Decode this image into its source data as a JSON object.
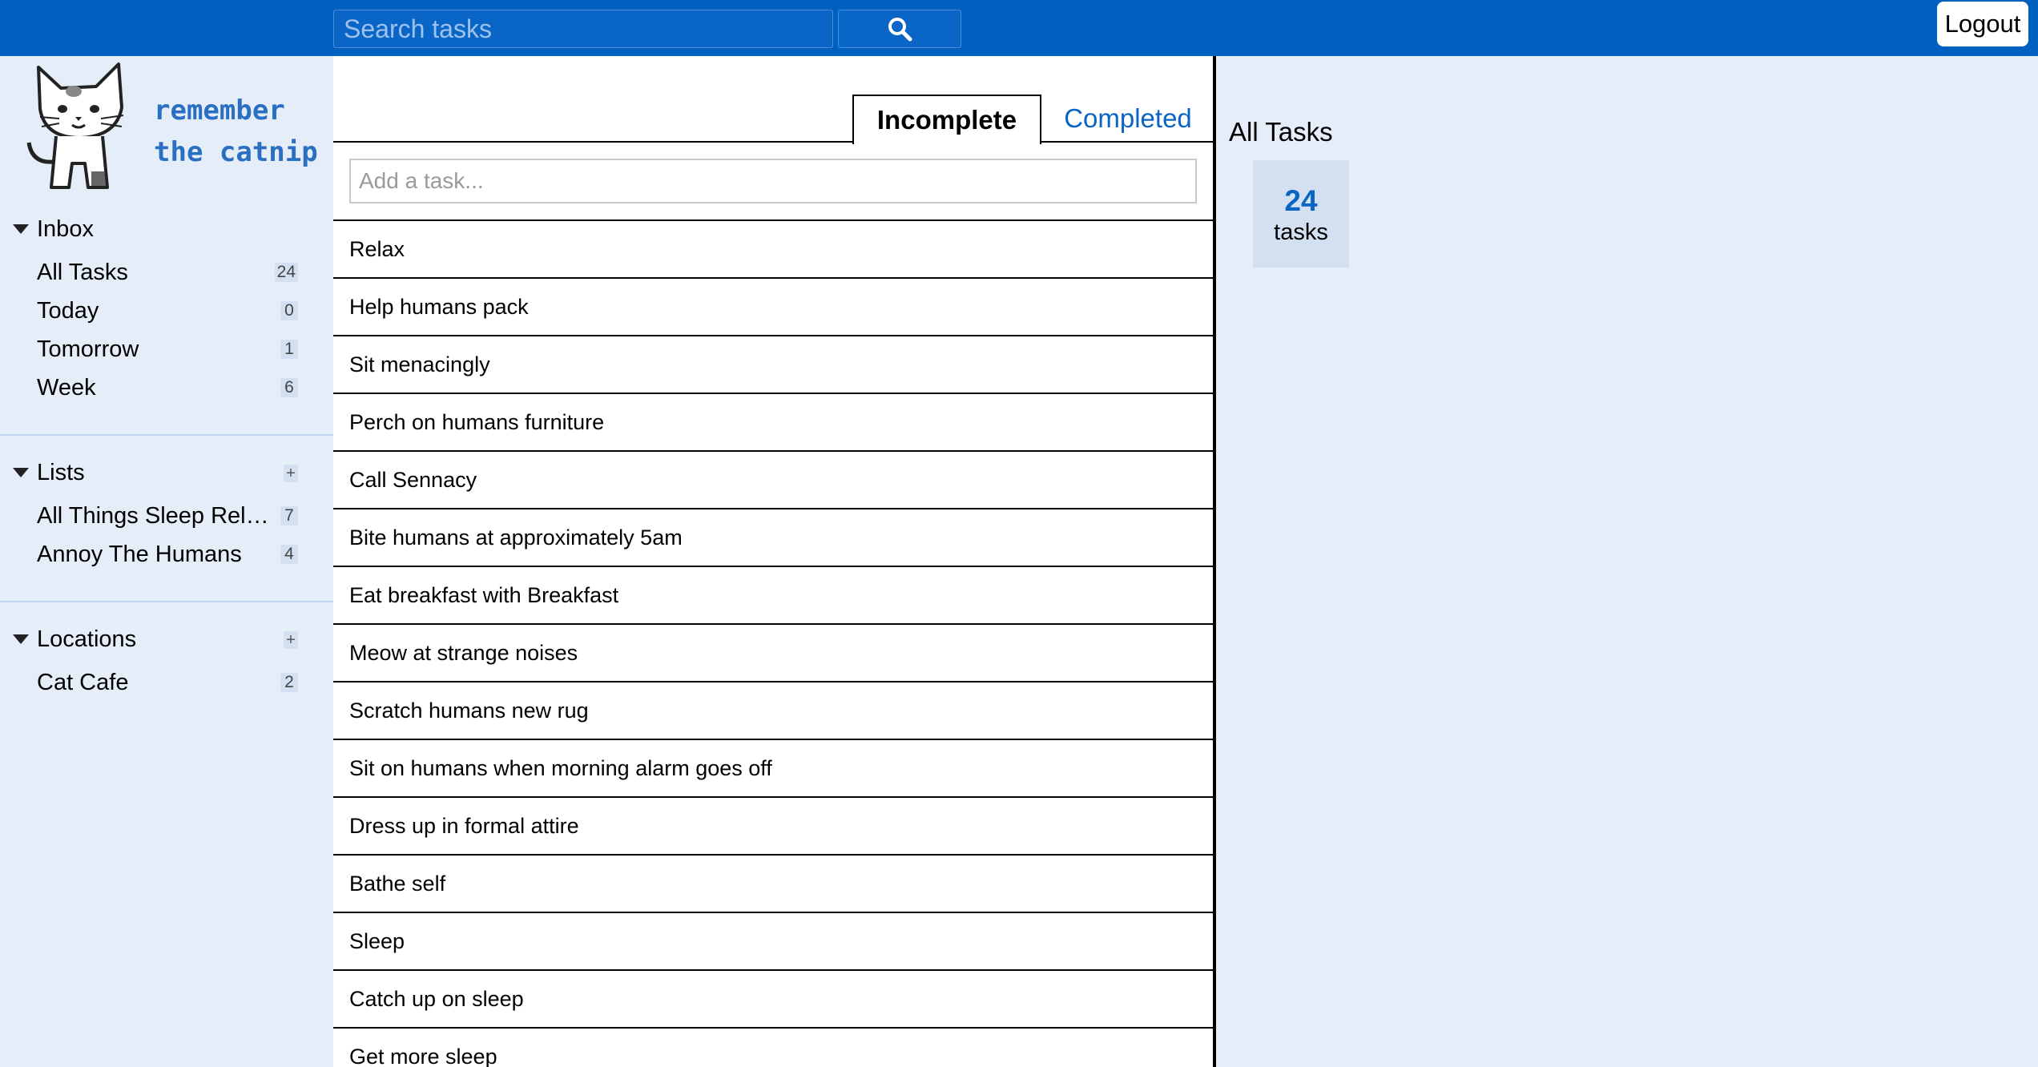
{
  "search": {
    "placeholder": "Search tasks"
  },
  "header": {
    "logout_label": "Logout"
  },
  "logo": {
    "line1": "remember",
    "line2": "the catnip"
  },
  "sidebar": {
    "inbox": {
      "title": "Inbox",
      "items": [
        {
          "label": "All Tasks",
          "count": "24"
        },
        {
          "label": "Today",
          "count": "0"
        },
        {
          "label": "Tomorrow",
          "count": "1"
        },
        {
          "label": "Week",
          "count": "6"
        }
      ]
    },
    "lists": {
      "title": "Lists",
      "add_label": "+",
      "items": [
        {
          "label": "All Things Sleep Rela…",
          "count": "7"
        },
        {
          "label": "Annoy The Humans",
          "count": "4"
        }
      ]
    },
    "locations": {
      "title": "Locations",
      "add_label": "+",
      "items": [
        {
          "label": "Cat Cafe",
          "count": "2"
        }
      ]
    }
  },
  "main": {
    "tabs": [
      {
        "label": "Incomplete",
        "active": true
      },
      {
        "label": "Completed",
        "active": false
      }
    ],
    "add_task_placeholder": "Add a task...",
    "tasks": [
      "Relax",
      "Help humans pack",
      "Sit menacingly",
      "Perch on humans furniture",
      "Call Sennacy",
      "Bite humans at approximately 5am",
      "Eat breakfast with Breakfast",
      "Meow at strange noises",
      "Scratch humans new rug",
      "Sit on humans when morning alarm goes off",
      "Dress up in formal attire",
      "Bathe self",
      "Sleep",
      "Catch up on sleep",
      "Get more sleep"
    ]
  },
  "detail": {
    "title": "All Tasks",
    "count": "24",
    "count_unit": "tasks"
  },
  "colors": {
    "topbar": "#0060c0",
    "panel_bg": "#e4edf8",
    "badge_bg": "#d3e0f1",
    "accent": "#0a64c2"
  },
  "icons": {
    "search": "search-icon",
    "logo": "cat-logo-icon",
    "collapse": "triangle-down-icon"
  }
}
